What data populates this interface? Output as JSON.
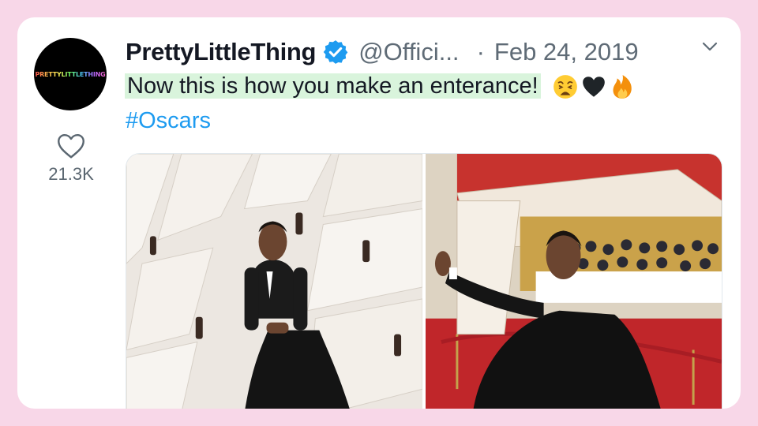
{
  "tweet": {
    "avatar_logo_text": "PRETTYLITTLETHING",
    "display_name": "PrettyLittleThing",
    "handle": "@Offici...",
    "separator": "·",
    "date": "Feb 24, 2019",
    "text": "Now this is how you make an enterance!",
    "emojis": [
      "weary-face-emoji",
      "black-heart-emoji",
      "fire-emoji"
    ],
    "hashtag": "#Oscars",
    "like_count": "21.3K",
    "accent_color": "#1d9bf0",
    "highlight_color": "#d9f4dc",
    "background_color": "#f8d7e8"
  },
  "media": {
    "photos": [
      {
        "name": "photo-left-red-carpet-pose"
      },
      {
        "name": "photo-right-red-carpet-wave"
      }
    ]
  }
}
